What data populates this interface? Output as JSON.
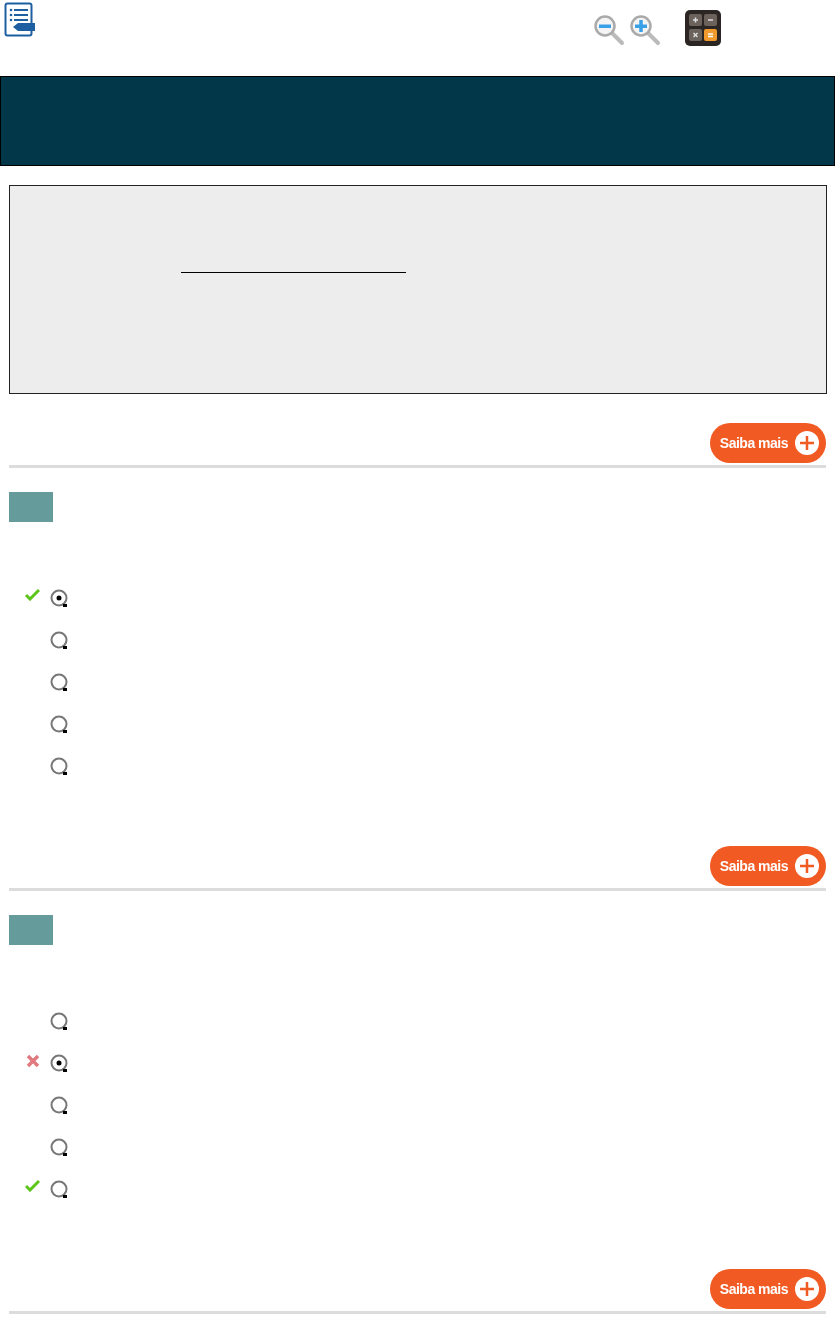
{
  "context": {
    "fill_in": true,
    "more_button": "Saiba mais"
  },
  "questions": [
    {
      "options": [
        {
          "selected": true,
          "kind": "correct"
        },
        {
          "selected": false,
          "kind": "plain"
        },
        {
          "selected": false,
          "kind": "plain"
        },
        {
          "selected": false,
          "kind": "plain"
        },
        {
          "selected": false,
          "kind": "plain"
        }
      ],
      "more_button": "Saiba mais"
    },
    {
      "options": [
        {
          "selected": false,
          "kind": "plain"
        },
        {
          "selected": true,
          "kind": "wrong"
        },
        {
          "selected": false,
          "kind": "plain"
        },
        {
          "selected": false,
          "kind": "plain"
        },
        {
          "selected": false,
          "kind": "correct"
        }
      ],
      "more_button": "Saiba mais"
    }
  ]
}
